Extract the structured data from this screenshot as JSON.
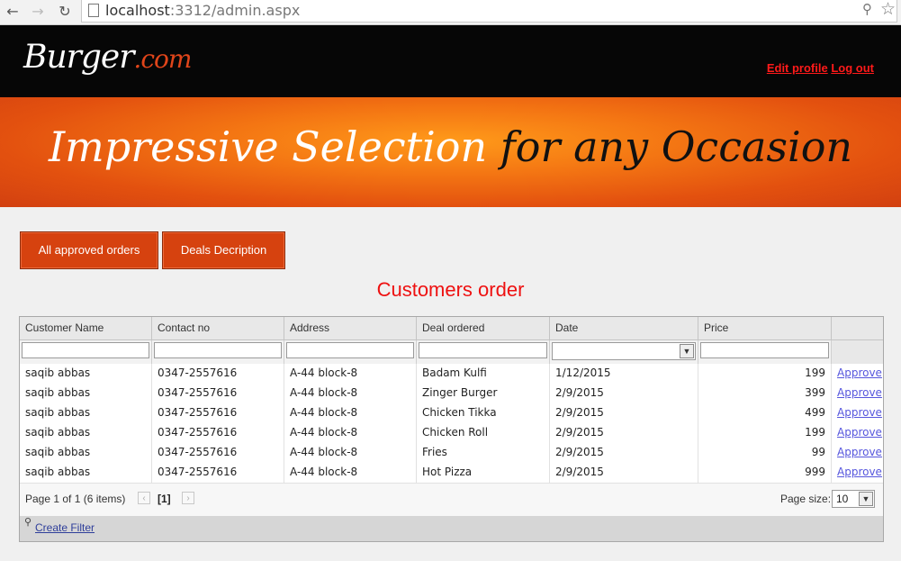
{
  "browser": {
    "url_host": "localhost",
    "url_rest": ":3312/admin.aspx"
  },
  "header": {
    "logo_main": "Burger",
    "logo_suffix": ".com",
    "edit_profile": "Edit profile",
    "logout": "Log out"
  },
  "banner": {
    "text_white": "Impressive Selection",
    "text_black": " for any Occasion"
  },
  "buttons": {
    "approved_orders": "All approved orders",
    "deals_description": "Deals Decription"
  },
  "page_title": "Customers order",
  "grid": {
    "columns": [
      "Customer Name",
      "Contact no",
      "Address",
      "Deal ordered",
      "Date",
      "Price"
    ],
    "rows": [
      {
        "name": "saqib abbas",
        "contact": "0347-2557616",
        "address": "A-44 block-8",
        "deal": "Badam Kulfi",
        "date": "1/12/2015",
        "price": "199",
        "action": "Approve"
      },
      {
        "name": "saqib abbas",
        "contact": "0347-2557616",
        "address": "A-44 block-8",
        "deal": "Zinger Burger",
        "date": "2/9/2015",
        "price": "399",
        "action": "Approve"
      },
      {
        "name": "saqib abbas",
        "contact": "0347-2557616",
        "address": "A-44 block-8",
        "deal": "Chicken Tikka",
        "date": "2/9/2015",
        "price": "499",
        "action": "Approve"
      },
      {
        "name": "saqib abbas",
        "contact": "0347-2557616",
        "address": "A-44 block-8",
        "deal": "Chicken Roll",
        "date": "2/9/2015",
        "price": "199",
        "action": "Approve"
      },
      {
        "name": "saqib abbas",
        "contact": "0347-2557616",
        "address": "A-44 block-8",
        "deal": "Fries",
        "date": "2/9/2015",
        "price": "99",
        "action": "Approve"
      },
      {
        "name": "saqib abbas",
        "contact": "0347-2557616",
        "address": "A-44 block-8",
        "deal": "Hot Pizza",
        "date": "2/9/2015",
        "price": "999",
        "action": "Approve"
      }
    ],
    "pager": {
      "summary": "Page 1 of 1 (6 items)",
      "current": "[1]",
      "page_size_label": "Page size:",
      "page_size_value": "10"
    },
    "create_filter": "Create Filter"
  },
  "colors": {
    "accent": "#d6420f",
    "heading": "#ee1111",
    "header_bg": "#060606"
  }
}
